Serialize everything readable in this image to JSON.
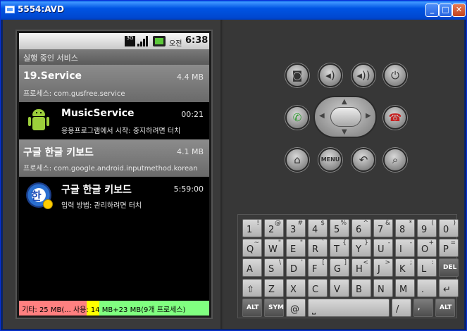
{
  "window": {
    "title": "5554:AVD"
  },
  "statusbar": {
    "network": "3G",
    "ampm": "오전",
    "time": "6:38"
  },
  "appbar": {
    "title": "실행 중인 서비스"
  },
  "services": [
    {
      "name": "19.Service",
      "size": "4.4 MB",
      "sub": "프로세스: com.gusfree.service",
      "style": "gray",
      "icon": "none"
    },
    {
      "name": "MusicService",
      "size": "00:21",
      "sub": "응용프로그램에서 시작: 중지하려면 터치",
      "style": "black",
      "icon": "android-icon"
    },
    {
      "name": "구글 한글 키보드",
      "size": "4.1 MB",
      "sub": "프로세스: com.google.android.inputmethod.korean",
      "style": "gray",
      "icon": "none"
    },
    {
      "name": "구글 한글 키보드",
      "size": "5:59:00",
      "sub": "입력 방법: 관리하려면 터치",
      "style": "black",
      "icon": "keyboard-app-icon"
    }
  ],
  "memory": {
    "label": "기타: 25 MB(... 사용: 14 MB+23 MB(9개 프로세스)"
  },
  "controls": {
    "dpad_center": "",
    "menu_label": "MENU"
  },
  "keyboard": {
    "rows": [
      [
        {
          "m": "1",
          "s": "!"
        },
        {
          "m": "2",
          "s": "@"
        },
        {
          "m": "3",
          "s": "#"
        },
        {
          "m": "4",
          "s": "$"
        },
        {
          "m": "5",
          "s": "%"
        },
        {
          "m": "6",
          "s": "^"
        },
        {
          "m": "7",
          "s": "&"
        },
        {
          "m": "8",
          "s": "*"
        },
        {
          "m": "9",
          "s": "("
        },
        {
          "m": "0",
          "s": ")"
        }
      ],
      [
        {
          "m": "Q",
          "s": "~"
        },
        {
          "m": "W",
          "s": "\""
        },
        {
          "m": "E",
          "s": "\""
        },
        {
          "m": "R",
          "s": "`"
        },
        {
          "m": "T",
          "s": "{"
        },
        {
          "m": "Y",
          "s": "}"
        },
        {
          "m": "U",
          "s": "-"
        },
        {
          "m": "I",
          "s": "-"
        },
        {
          "m": "O",
          "s": "+"
        },
        {
          "m": "P",
          "s": "="
        }
      ],
      [
        {
          "m": "A",
          "s": ""
        },
        {
          "m": "S",
          "s": "\\"
        },
        {
          "m": "D",
          "s": "'"
        },
        {
          "m": "F",
          "s": "["
        },
        {
          "m": "G",
          "s": "]"
        },
        {
          "m": "H",
          "s": "<"
        },
        {
          "m": "J",
          "s": ">"
        },
        {
          "m": "K",
          "s": ";"
        },
        {
          "m": "L",
          "s": ":"
        },
        {
          "m": "DEL",
          "s": ""
        }
      ],
      [
        {
          "m": "⇧",
          "s": ""
        },
        {
          "m": "Z",
          "s": ""
        },
        {
          "m": "X",
          "s": ""
        },
        {
          "m": "C",
          "s": ""
        },
        {
          "m": "V",
          "s": ""
        },
        {
          "m": "B",
          "s": ""
        },
        {
          "m": "N",
          "s": ""
        },
        {
          "m": "M",
          "s": ""
        },
        {
          "m": ".",
          "s": ""
        },
        {
          "m": "↵",
          "s": ""
        }
      ],
      [
        {
          "m": "ALT",
          "s": ""
        },
        {
          "m": "SYM",
          "s": ""
        },
        {
          "m": "@",
          "s": ""
        },
        {
          "m": "space",
          "s": ""
        },
        {
          "m": "/",
          "s": ""
        },
        {
          "m": ",",
          "s": ""
        },
        {
          "m": "ALT",
          "s": ""
        }
      ]
    ]
  },
  "colors": {
    "memory_other": "#ff8080",
    "memory_used": "#ffff00",
    "memory_free": "#80ff80"
  }
}
